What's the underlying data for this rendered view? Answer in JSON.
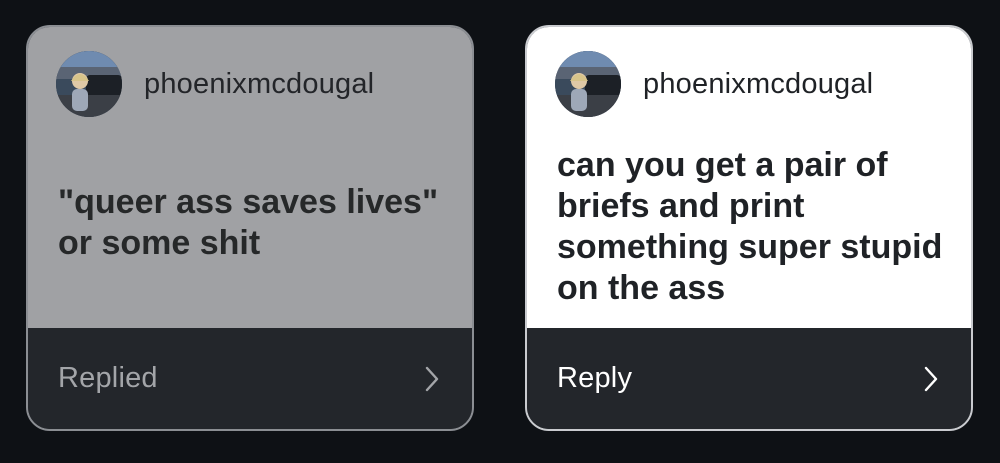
{
  "cards": [
    {
      "username": "phoenixmcdougal",
      "question": "\"queer ass saves lives\" or some shit",
      "footer_label": "Replied",
      "state": "replied",
      "avatar_icon": "profile-photo"
    },
    {
      "username": "phoenixmcdougal",
      "question": "can you get a pair of briefs and print something super stupid on the ass",
      "footer_label": "Reply",
      "state": "unreplied",
      "avatar_icon": "profile-photo"
    }
  ],
  "colors": {
    "background": "#0e1115",
    "replied_card": "#a0a1a4",
    "active_card": "#ffffff",
    "footer": "#23262b"
  }
}
